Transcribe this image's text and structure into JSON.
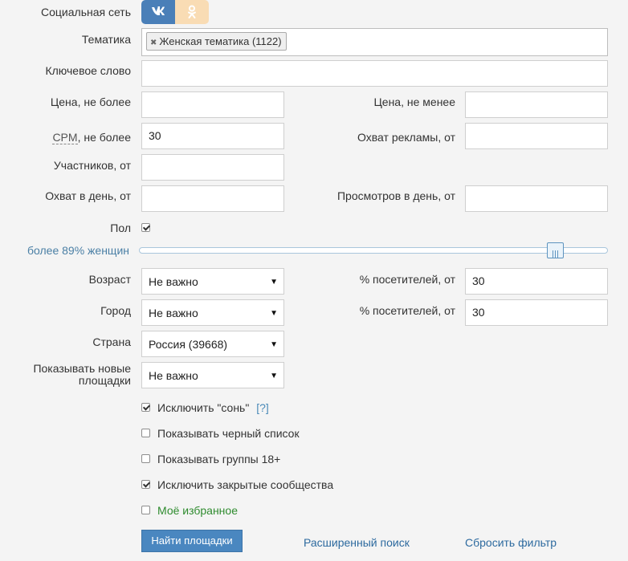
{
  "social": {
    "label": "Социальная сеть",
    "vk_label": "vk",
    "ok_label": "ok"
  },
  "topic": {
    "label": "Тематика",
    "tag": "Женская тематика (1122)",
    "tag_remove": "✖"
  },
  "keyword": {
    "label": "Ключевое слово",
    "value": ""
  },
  "price_max": {
    "label": "Цена, не более",
    "value": ""
  },
  "price_min": {
    "label": "Цена, не менее",
    "value": ""
  },
  "cpm": {
    "label_abbr": "CPM",
    "label_rest": ", не более",
    "value": "30"
  },
  "ad_reach": {
    "label": "Охват рекламы, от",
    "value": ""
  },
  "members": {
    "label": "Участников, от",
    "value": ""
  },
  "daily_reach": {
    "label": "Охват в день, от",
    "value": ""
  },
  "daily_views": {
    "label": "Просмотров в день, от",
    "value": ""
  },
  "gender": {
    "label": "Пол",
    "checked": true,
    "slider_text": "более 89% женщин",
    "slider_level": 0.89
  },
  "age": {
    "label": "Возраст",
    "value": "Не важно",
    "visitors_label": "% посетителей, от",
    "visitors_value": "30"
  },
  "city": {
    "label": "Город",
    "value": "Не важно",
    "visitors_label": "% посетителей, от",
    "visitors_value": "30"
  },
  "country": {
    "label": "Страна",
    "value": "Россия (39668)"
  },
  "new_sites": {
    "label_line1": "Показывать новые",
    "label_line2": "площадки",
    "value": "Не важно"
  },
  "options": {
    "exclude_sleeping": {
      "label": "Исключить \"сонь\"",
      "help": "[?]",
      "checked": true
    },
    "show_blacklist": {
      "label": "Показывать черный список",
      "checked": false
    },
    "show_18": {
      "label": "Показывать группы 18+",
      "checked": false
    },
    "exclude_closed": {
      "label": "Исключить закрытые сообщества",
      "checked": true
    },
    "favorites": {
      "label": "Моё избранное",
      "checked": false
    }
  },
  "actions": {
    "find_button": "Найти площадки",
    "advanced_search": "Расширенный поиск",
    "reset_filter": "Сбросить фильтр"
  },
  "colors": {
    "accent_blue": "#4a7fb8",
    "ok_orange_light": "#f9dcb4",
    "favorites_green": "#2e8b2e",
    "link_blue": "#2d6a9f",
    "slider_label": "#4a7fa5"
  },
  "icons": {
    "vk": "vk-icon",
    "ok": "odnoklassniki-icon",
    "dropdown": "triangle-down-icon",
    "slider_handle": "grip-lines-icon"
  }
}
